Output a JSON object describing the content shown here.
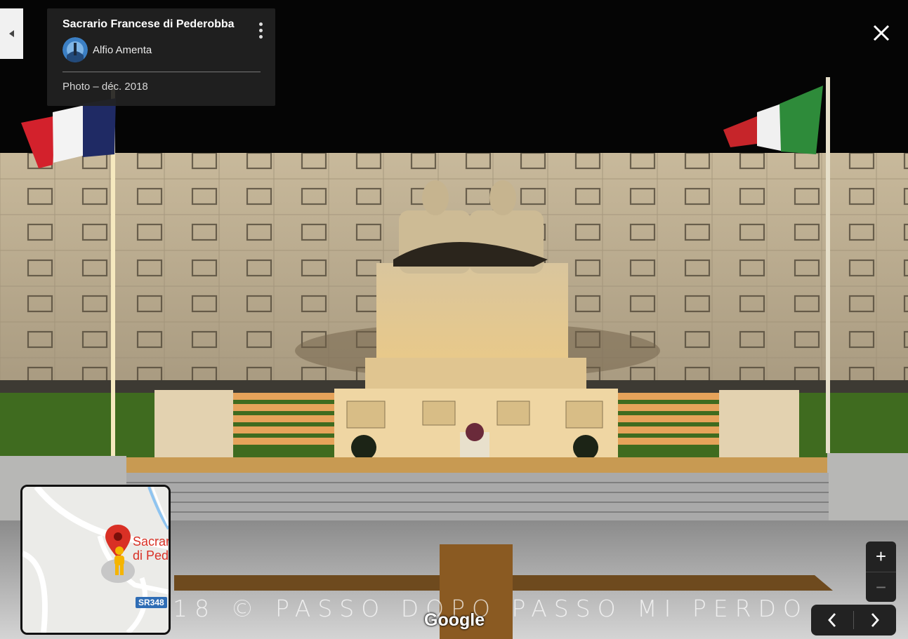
{
  "place": {
    "title": "Sacrario Francese di Pederobba",
    "author": "Alfio Amenta",
    "photo_date": "Photo – déc. 2018"
  },
  "minimap": {
    "place_label": "Sacrar\ndi Ped",
    "road_shield": "SR348"
  },
  "controls": {
    "zoom_in": "+",
    "zoom_out": "−"
  },
  "watermark": "18 © PASSO DOPO PASSO MI PERDO",
  "brand": "Google",
  "colors": {
    "card_bg": "#222222",
    "map_pin": "#d93025",
    "pegman": "#f5b400",
    "road_shield": "#2f6db5"
  },
  "icons": {
    "back": "triangle-left-icon",
    "more": "more-vert-icon",
    "close": "close-icon",
    "prev": "chevron-left-icon",
    "next": "chevron-right-icon",
    "pin": "map-pin-icon",
    "pegman": "pegman-icon"
  }
}
